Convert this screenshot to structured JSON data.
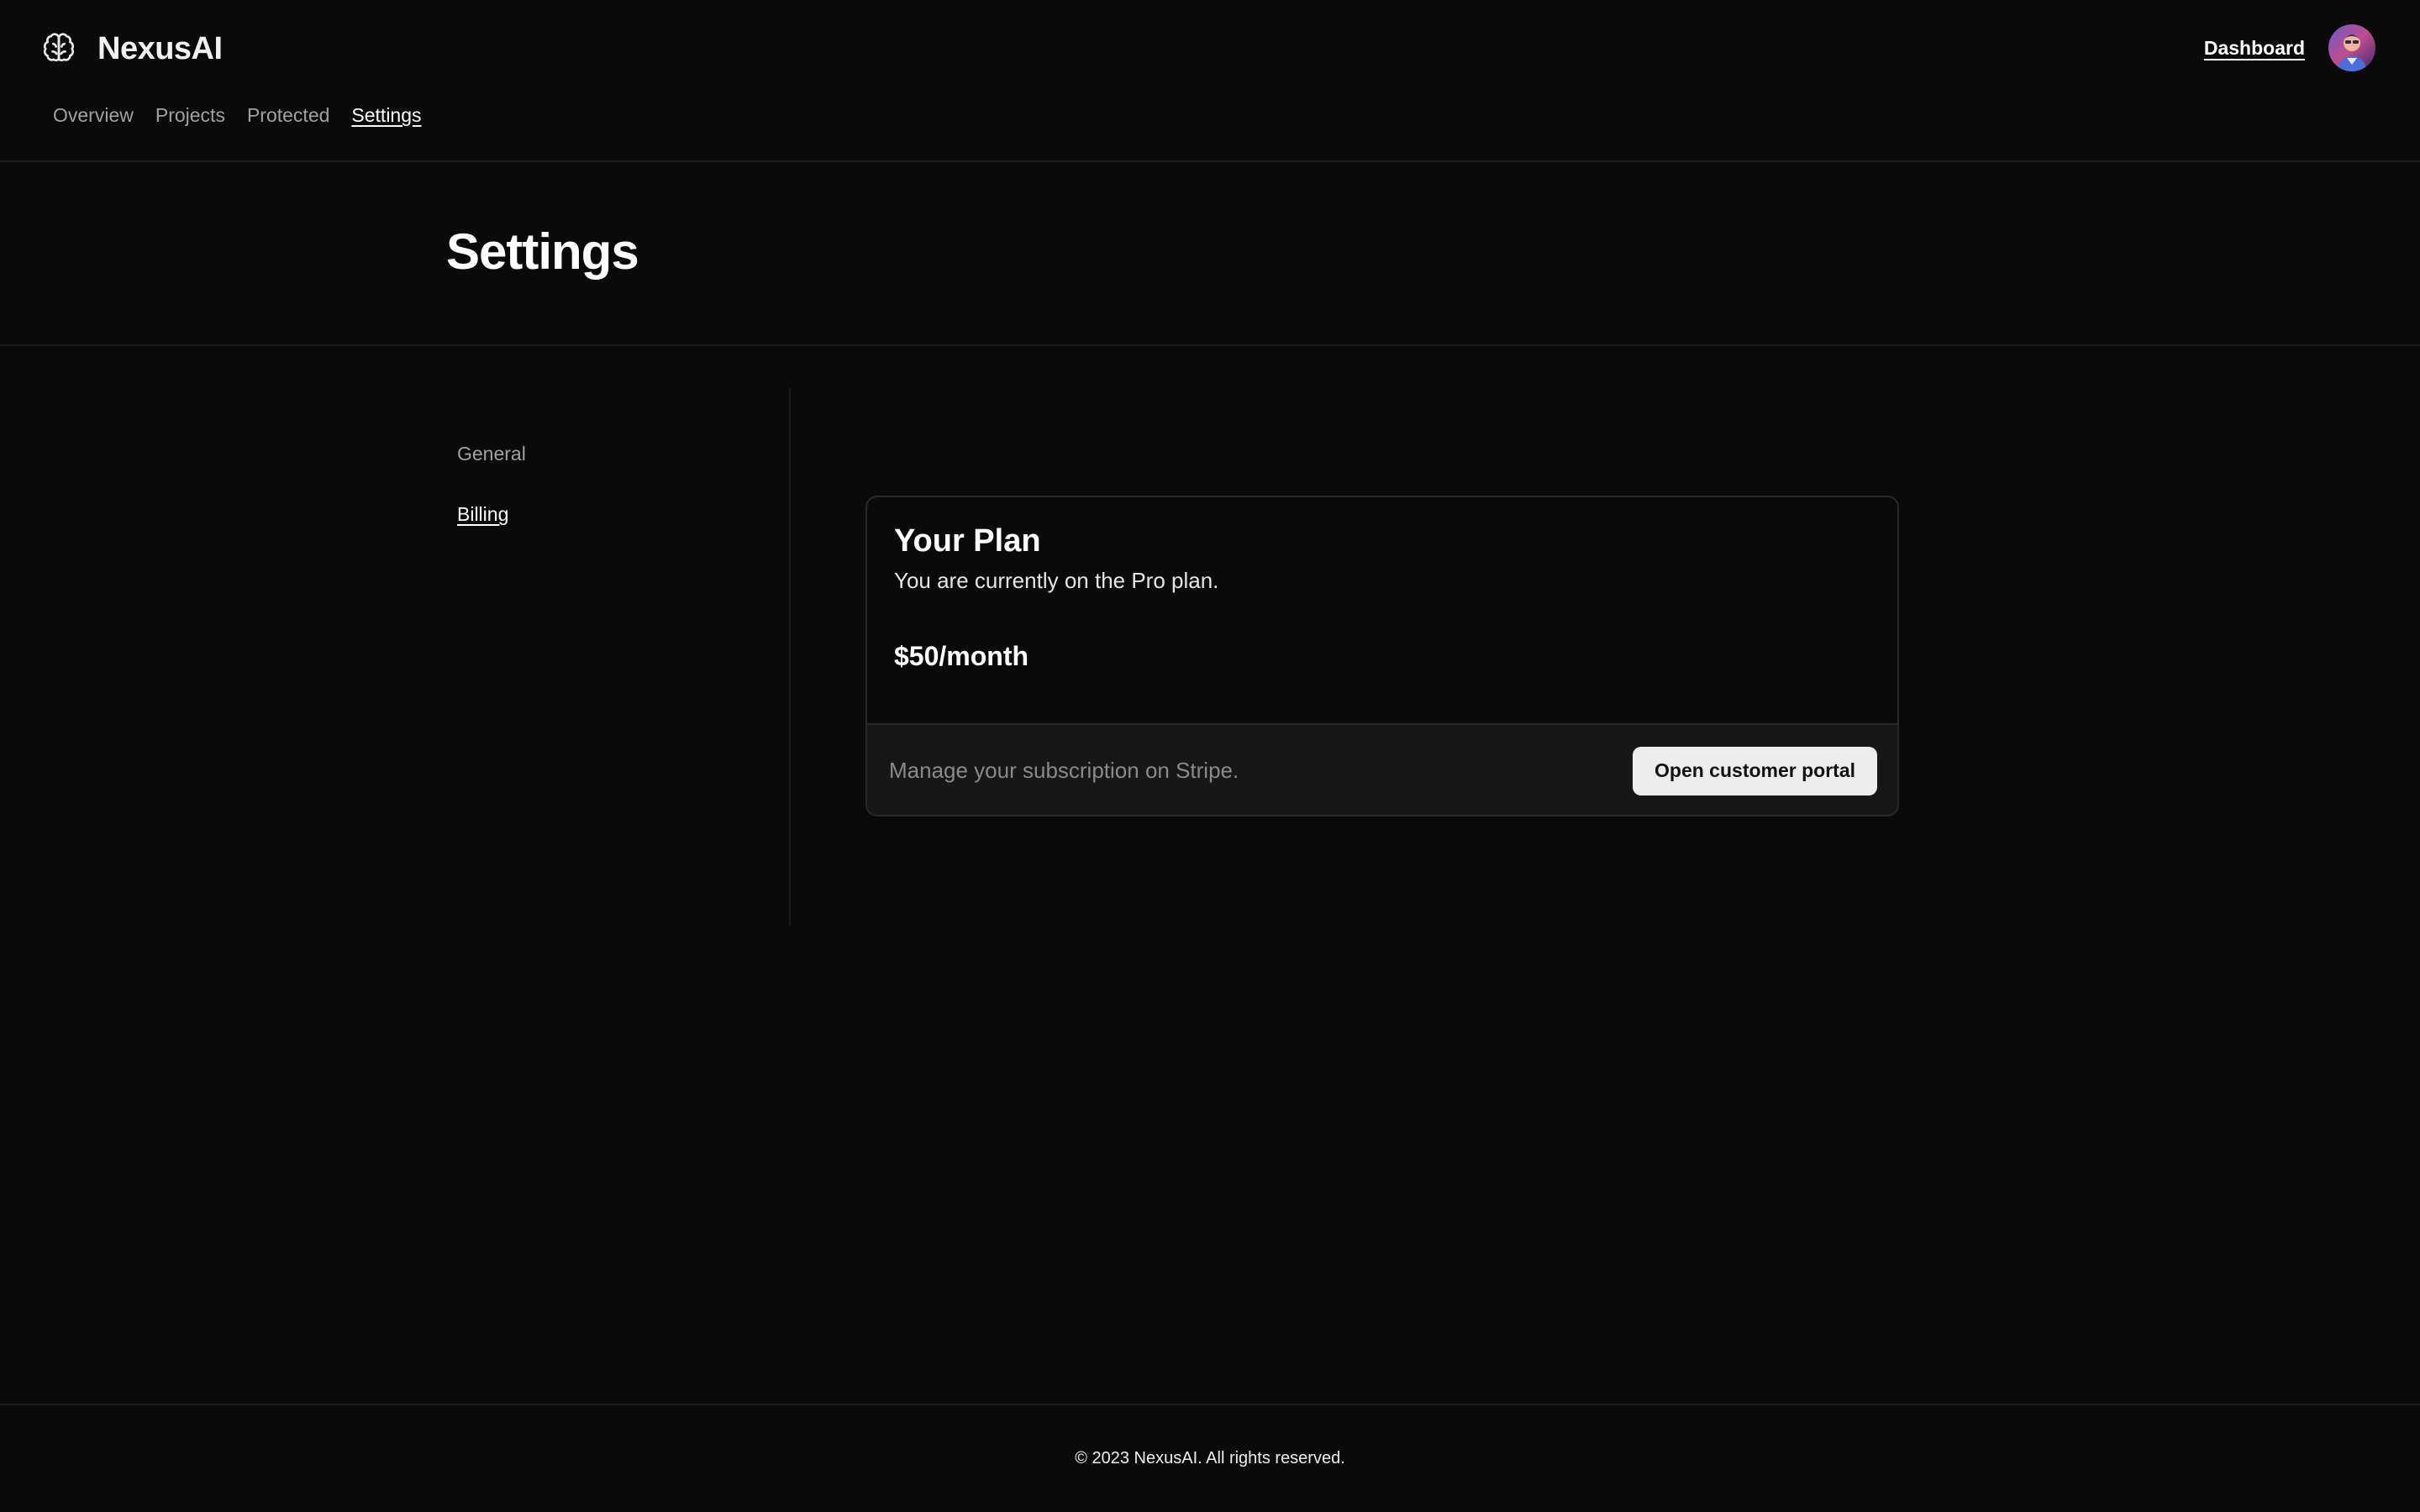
{
  "header": {
    "brand_name": "NexusAI",
    "brand_icon": "brain-icon",
    "nav": [
      {
        "label": "Overview",
        "active": false
      },
      {
        "label": "Projects",
        "active": false
      },
      {
        "label": "Protected",
        "active": false
      },
      {
        "label": "Settings",
        "active": true
      }
    ],
    "dashboard_label": "Dashboard",
    "avatar_icon": "user-avatar"
  },
  "page": {
    "title": "Settings"
  },
  "sidebar": {
    "items": [
      {
        "label": "General",
        "active": false
      },
      {
        "label": "Billing",
        "active": true
      }
    ]
  },
  "plan_card": {
    "title": "Your Plan",
    "description": "You are currently on the Pro plan.",
    "price": "$50/month",
    "footer_text": "Manage your subscription on Stripe.",
    "button_label": "Open customer portal"
  },
  "footer": {
    "text": "© 2023 NexusAI. All rights reserved."
  },
  "colors": {
    "background": "#0a0a0a",
    "card_footer": "#171717",
    "button_bg": "#ededed",
    "muted_text": "#a1a1a1"
  }
}
